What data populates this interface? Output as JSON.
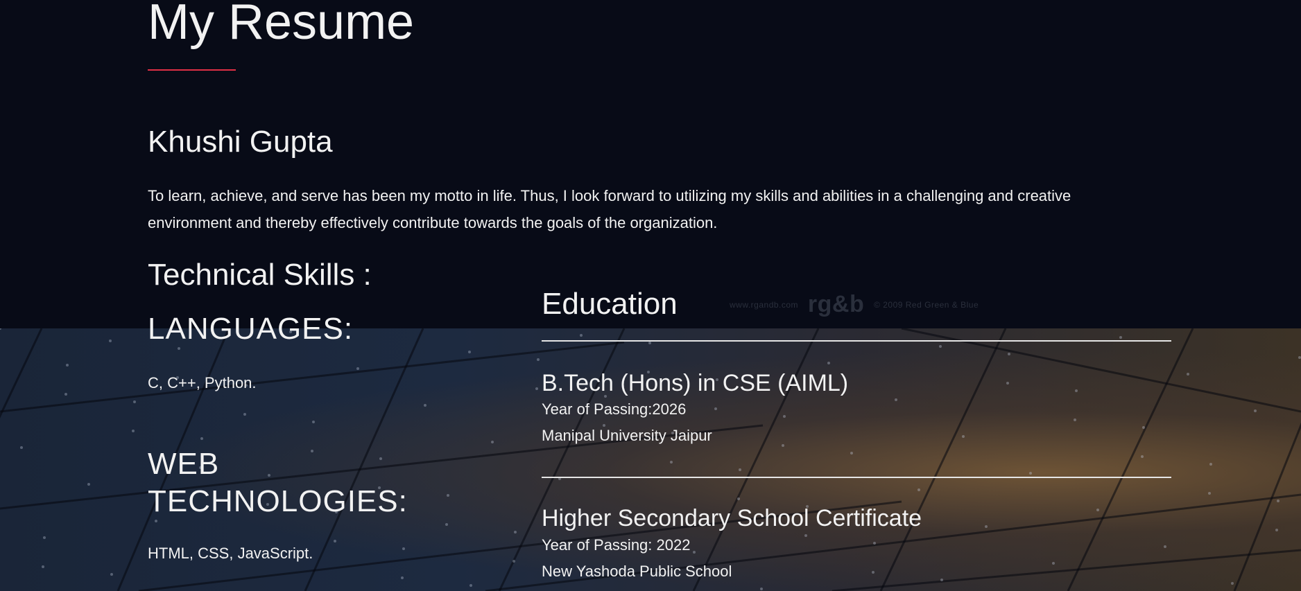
{
  "header": {
    "title": "My Resume",
    "accent_color": "#e03045"
  },
  "profile": {
    "name": "Khushi Gupta",
    "summary": "To learn, achieve, and serve has been my motto in life. Thus, I look forward to utilizing my skills and abilities in a challenging and creative environment and thereby effectively contribute towards the goals of the organization."
  },
  "skills": {
    "heading": "Technical Skills :",
    "languages_heading": "LANGUAGES:",
    "languages": "C, C++, Python.",
    "web_heading": "WEB TECHNOLOGIES:",
    "web": "HTML, CSS, JavaScript."
  },
  "education": {
    "heading": "Education",
    "entries": [
      {
        "degree": "B.Tech (Hons) in CSE (AIML)",
        "year": "Year of Passing:2026",
        "institution": "Manipal University Jaipur"
      },
      {
        "degree": "Higher Secondary School Certificate",
        "year": "Year of Passing: 2022",
        "institution": "New Yashoda Public School"
      }
    ]
  },
  "background_watermark": {
    "left_text": "www.rgandb.com",
    "logo_text": "rg&b",
    "right_text": "© 2009 Red Green & Blue"
  }
}
